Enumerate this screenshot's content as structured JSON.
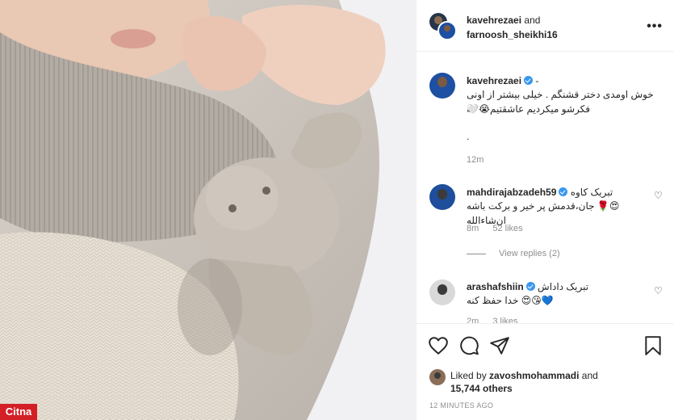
{
  "brand": {
    "label": "Citna"
  },
  "header": {
    "user1": "kavehrezaei",
    "and": "and",
    "user2": "farnoosh_sheikhi16",
    "more": "•••"
  },
  "caption": {
    "username": "kavehrezaei",
    "suffix": "-",
    "line1": "خوش اومدی دختر قشنگم . خیلی بیشتر از اونی که",
    "line2": "فکرشو میکردیم عاشقتیم😭🤍",
    "line3": ".",
    "time": "12m"
  },
  "comments": [
    {
      "username": "mahdirajabzadeh59",
      "line1": "تبریک کاوه",
      "line2": "😍🌹 جان،قدمش پر خیر و برکت باشه ان‌شاءالله",
      "time": "8m",
      "likes": "52 likes",
      "replies": "View replies (2)"
    },
    {
      "username": "arashafshiin",
      "line1": "تبریک داداش",
      "line2": "💙😘😍 خدا حفظ کنه",
      "time": "2m",
      "likes": "3 likes"
    }
  ],
  "likes": {
    "prefix": "Liked by",
    "user": "zavoshmohammadi",
    "and": "and",
    "count": "15,744 others"
  },
  "timeago": "12 MINUTES AGO",
  "icons": [
    "heart-icon",
    "comment-icon",
    "share-icon",
    "bookmark-icon",
    "more-icon",
    "verified-icon"
  ],
  "colors": {
    "verified": "#3897f0",
    "muted": "#8e8e8e",
    "brand": "#d31f26"
  }
}
